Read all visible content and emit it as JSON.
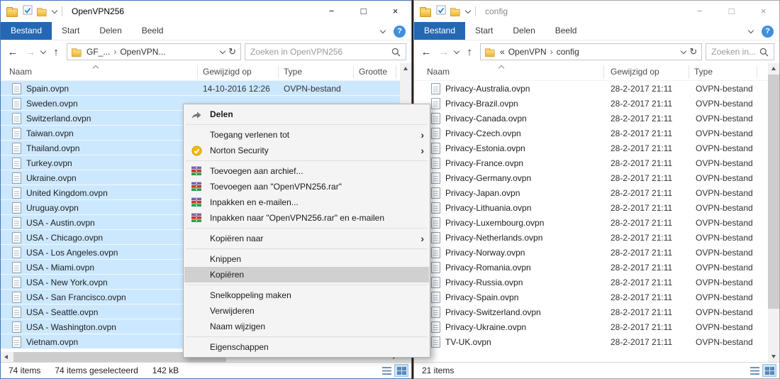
{
  "colors": {
    "accent": "#2468b4",
    "selection": "#cce8ff",
    "menu_highlight": "#d0d0d0",
    "help": "#3f8fdd"
  },
  "icons": {
    "minimize": "−",
    "maximize": "□",
    "close": "×",
    "back": "←",
    "forward": "→",
    "up": "↑",
    "refresh": "↻",
    "help": "?",
    "overflow": "«",
    "crumb_sep": "›"
  },
  "left_window": {
    "title": "OpenVPN256",
    "tabs": [
      "Bestand",
      "Start",
      "Delen",
      "Beeld"
    ],
    "active_tab": "Bestand",
    "address": {
      "crumbs": [
        "GF_...",
        "OpenVPN..."
      ]
    },
    "search_placeholder": "Zoeken in OpenVPN256",
    "columns": {
      "name": "Naam",
      "modified": "Gewijzigd op",
      "type": "Type",
      "size": "Grootte"
    },
    "files": [
      {
        "name": "Spain.ovpn",
        "date": "14-10-2016 12:26",
        "type": "OVPN-bestand"
      },
      {
        "name": "Sweden.ovpn"
      },
      {
        "name": "Switzerland.ovpn"
      },
      {
        "name": "Taiwan.ovpn"
      },
      {
        "name": "Thailand.ovpn"
      },
      {
        "name": "Turkey.ovpn"
      },
      {
        "name": "Ukraine.ovpn"
      },
      {
        "name": "United Kingdom.ovpn"
      },
      {
        "name": "Uruguay.ovpn"
      },
      {
        "name": "USA - Austin.ovpn"
      },
      {
        "name": "USA - Chicago.ovpn"
      },
      {
        "name": "USA - Los Angeles.ovpn"
      },
      {
        "name": "USA - Miami.ovpn"
      },
      {
        "name": "USA - New York.ovpn"
      },
      {
        "name": "USA - San Francisco.ovpn"
      },
      {
        "name": "USA - Seattle.ovpn"
      },
      {
        "name": "USA - Washington.ovpn"
      },
      {
        "name": "Vietnam.ovpn"
      }
    ],
    "selected": true,
    "status": {
      "items": "74 items",
      "selected": "74 items geselecteerd",
      "size": "142 kB"
    }
  },
  "right_window": {
    "title": "config",
    "tabs": [
      "Bestand",
      "Start",
      "Delen",
      "Beeld"
    ],
    "active_tab": "Bestand",
    "address": {
      "overflow": "«",
      "crumbs": [
        "OpenVPN",
        "config"
      ]
    },
    "search_placeholder": "Zoeken in...",
    "columns": {
      "name": "Naam",
      "modified": "Gewijzigd op",
      "type": "Type"
    },
    "files": [
      {
        "name": "Privacy-Australia.ovpn",
        "date": "28-2-2017 21:11",
        "type": "OVPN-bestand"
      },
      {
        "name": "Privacy-Brazil.ovpn",
        "date": "28-2-2017 21:11",
        "type": "OVPN-bestand"
      },
      {
        "name": "Privacy-Canada.ovpn",
        "date": "28-2-2017 21:11",
        "type": "OVPN-bestand"
      },
      {
        "name": "Privacy-Czech.ovpn",
        "date": "28-2-2017 21:11",
        "type": "OVPN-bestand"
      },
      {
        "name": "Privacy-Estonia.ovpn",
        "date": "28-2-2017 21:11",
        "type": "OVPN-bestand"
      },
      {
        "name": "Privacy-France.ovpn",
        "date": "28-2-2017 21:11",
        "type": "OVPN-bestand"
      },
      {
        "name": "Privacy-Germany.ovpn",
        "date": "28-2-2017 21:11",
        "type": "OVPN-bestand"
      },
      {
        "name": "Privacy-Japan.ovpn",
        "date": "28-2-2017 21:11",
        "type": "OVPN-bestand"
      },
      {
        "name": "Privacy-Lithuania.ovpn",
        "date": "28-2-2017 21:11",
        "type": "OVPN-bestand"
      },
      {
        "name": "Privacy-Luxembourg.ovpn",
        "date": "28-2-2017 21:11",
        "type": "OVPN-bestand"
      },
      {
        "name": "Privacy-Netherlands.ovpn",
        "date": "28-2-2017 21:11",
        "type": "OVPN-bestand"
      },
      {
        "name": "Privacy-Norway.ovpn",
        "date": "28-2-2017 21:11",
        "type": "OVPN-bestand"
      },
      {
        "name": "Privacy-Romania.ovpn",
        "date": "28-2-2017 21:11",
        "type": "OVPN-bestand"
      },
      {
        "name": "Privacy-Russia.ovpn",
        "date": "28-2-2017 21:11",
        "type": "OVPN-bestand"
      },
      {
        "name": "Privacy-Spain.ovpn",
        "date": "28-2-2017 21:11",
        "type": "OVPN-bestand"
      },
      {
        "name": "Privacy-Switzerland.ovpn",
        "date": "28-2-2017 21:11",
        "type": "OVPN-bestand"
      },
      {
        "name": "Privacy-Ukraine.ovpn",
        "date": "28-2-2017 21:11",
        "type": "OVPN-bestand"
      },
      {
        "name": "TV-UK.ovpn",
        "date": "28-2-2017 21:11",
        "type": "OVPN-bestand"
      }
    ],
    "selected": false,
    "status": {
      "items": "21 items"
    }
  },
  "context_menu": {
    "submenu_arrow": "›",
    "items": [
      {
        "label": "Delen",
        "icon": "share",
        "bold": true
      },
      {
        "sep": true
      },
      {
        "label": "Toegang verlenen tot",
        "submenu": true
      },
      {
        "label": "Norton Security",
        "icon": "norton",
        "submenu": true
      },
      {
        "sep": true
      },
      {
        "label": "Toevoegen aan archief...",
        "icon": "winrar"
      },
      {
        "label": "Toevoegen aan \"OpenVPN256.rar\"",
        "icon": "winrar"
      },
      {
        "label": "Inpakken en e-mailen...",
        "icon": "winrar"
      },
      {
        "label": "Inpakken naar \"OpenVPN256.rar\" en e-mailen",
        "icon": "winrar"
      },
      {
        "sep": true
      },
      {
        "label": "Kopiëren naar",
        "submenu": true
      },
      {
        "sep": true
      },
      {
        "label": "Knippen"
      },
      {
        "label": "Kopiëren",
        "highlight": true
      },
      {
        "sep": true
      },
      {
        "label": "Snelkoppeling maken"
      },
      {
        "label": "Verwijderen"
      },
      {
        "label": "Naam wijzigen"
      },
      {
        "sep": true
      },
      {
        "label": "Eigenschappen"
      }
    ]
  }
}
